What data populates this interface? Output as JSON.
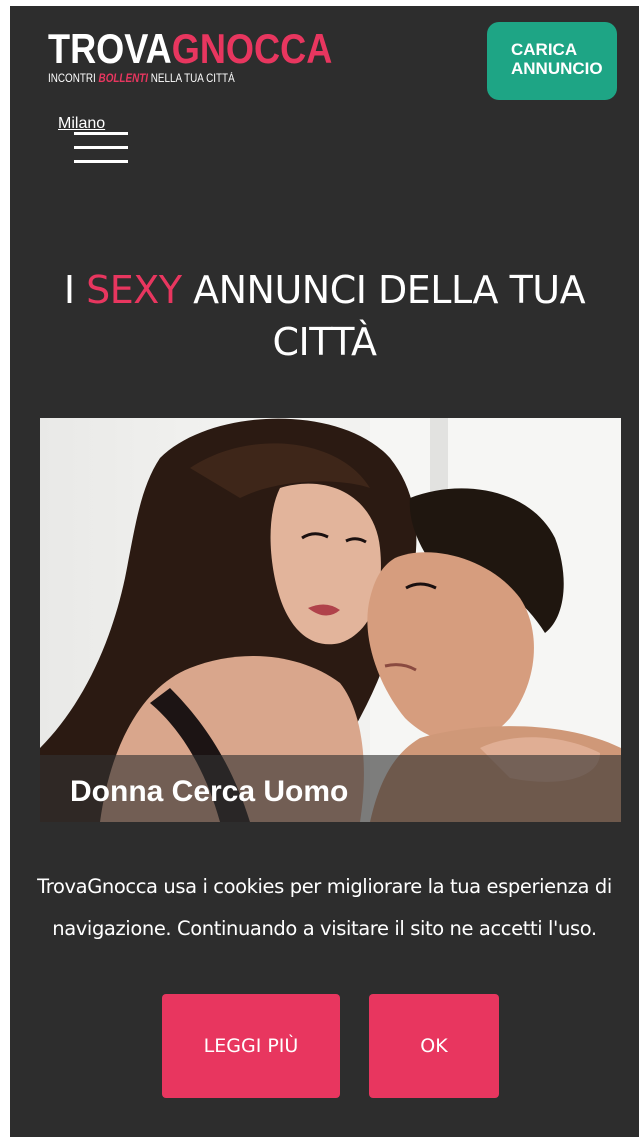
{
  "header": {
    "logo_part1": "TROVA",
    "logo_part2": "GNOCCA",
    "tagline_before": "INCONTRI ",
    "tagline_hot": "BOLLENTI",
    "tagline_after": " NELLA TUA CITTÀ",
    "upload_line1": "CARICA",
    "upload_line2": "ANNUNCIO",
    "city": "Milano"
  },
  "headline": {
    "part1": "I ",
    "highlight": "SEXY",
    "part2": " ANNUNCI DELLA TUA CITTÀ"
  },
  "hero": {
    "caption": "Donna Cerca Uomo"
  },
  "cookie": {
    "text": "TrovaGnocca usa i cookies per migliorare la tua esperienza di navigazione. Continuando a visitare il sito ne accetti l'uso.",
    "more_label": "LEGGI PIÙ",
    "ok_label": "OK"
  },
  "colors": {
    "background": "#2d2d2d",
    "accent_pink": "#e8365f",
    "upload_green": "#1ea585",
    "text": "#ffffff"
  },
  "icons": {
    "menu": "hamburger-menu-icon"
  }
}
